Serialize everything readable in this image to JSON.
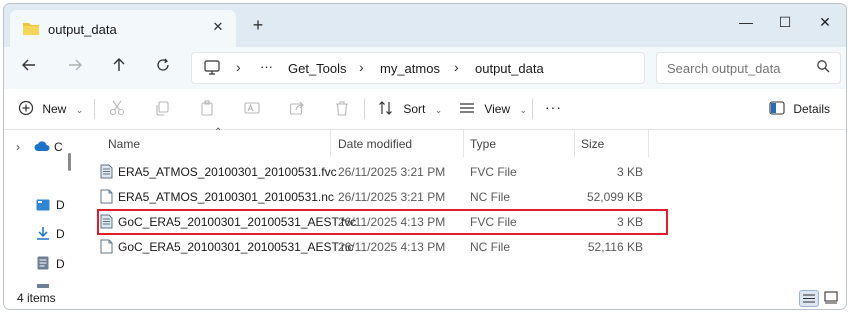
{
  "tab": {
    "title": "output_data",
    "close": "✕",
    "new": "+"
  },
  "window_controls": {
    "minimize": "—",
    "maximize": "☐",
    "close": "✕"
  },
  "address": {
    "ellipsis": "···",
    "crumbs": [
      "Get_Tools",
      "my_atmos",
      "output_data"
    ]
  },
  "search": {
    "placeholder": "Search output_data"
  },
  "toolbar": {
    "new_label": "New",
    "sort_label": "Sort",
    "view_label": "View",
    "more_label": "···",
    "details_label": "Details"
  },
  "nav": {
    "items": [
      "C",
      "D",
      "D",
      "D"
    ]
  },
  "columns": {
    "name": "Name",
    "date": "Date modified",
    "type": "Type",
    "size": "Size"
  },
  "files": [
    {
      "name": "ERA5_ATMOS_20100301_20100531.fvc",
      "date": "26/11/2025 3:21 PM",
      "type": "FVC File",
      "size": "3 KB",
      "icon": "fvc-file-icon"
    },
    {
      "name": "ERA5_ATMOS_20100301_20100531.nc",
      "date": "26/11/2025 3:21 PM",
      "type": "NC File",
      "size": "52,099 KB",
      "icon": "nc-file-icon"
    },
    {
      "name": "GoC_ERA5_20100301_20100531_AEST.fvc",
      "date": "26/11/2025 4:13 PM",
      "type": "FVC File",
      "size": "3 KB",
      "icon": "fvc-file-icon"
    },
    {
      "name": "GoC_ERA5_20100301_20100531_AEST.nc",
      "date": "26/11/2025 4:13 PM",
      "type": "NC File",
      "size": "52,116 KB",
      "icon": "nc-file-icon"
    }
  ],
  "status": {
    "count": "4 items"
  },
  "colors": {
    "highlight": "#e11d2a",
    "tabbar": "#dfeaf2",
    "folder": "#f2c23a"
  }
}
